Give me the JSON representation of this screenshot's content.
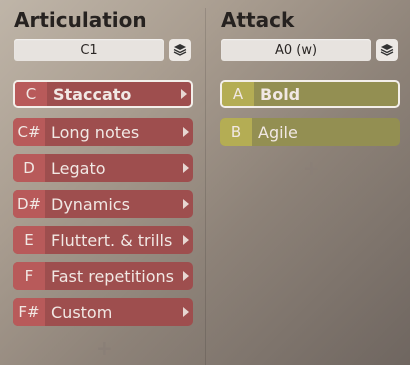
{
  "articulation": {
    "title": "Articulation",
    "preset": "C1",
    "items": [
      {
        "key": "C",
        "label": "Staccato",
        "selected": true
      },
      {
        "key": "C#",
        "label": "Long notes"
      },
      {
        "key": "D",
        "label": "Legato"
      },
      {
        "key": "D#",
        "label": "Dynamics"
      },
      {
        "key": "E",
        "label": "Fluttert. & trills"
      },
      {
        "key": "F",
        "label": "Fast repetitions"
      },
      {
        "key": "F#",
        "label": "Custom"
      }
    ],
    "add_label": "+"
  },
  "attack": {
    "title": "Attack",
    "preset": "A0 (w)",
    "items": [
      {
        "key": "A",
        "label": "Bold",
        "selected": true
      },
      {
        "key": "B",
        "label": "Agile"
      }
    ],
    "add_label": "+"
  },
  "icons": {
    "layers": "layers-icon",
    "arrow": "chevron-right-icon",
    "add": "plus-icon"
  },
  "colors": {
    "articulation_row": "#9e4e4e",
    "articulation_key": "#b85a5a",
    "attack_row": "#938f52",
    "attack_key": "#b4ad54"
  }
}
